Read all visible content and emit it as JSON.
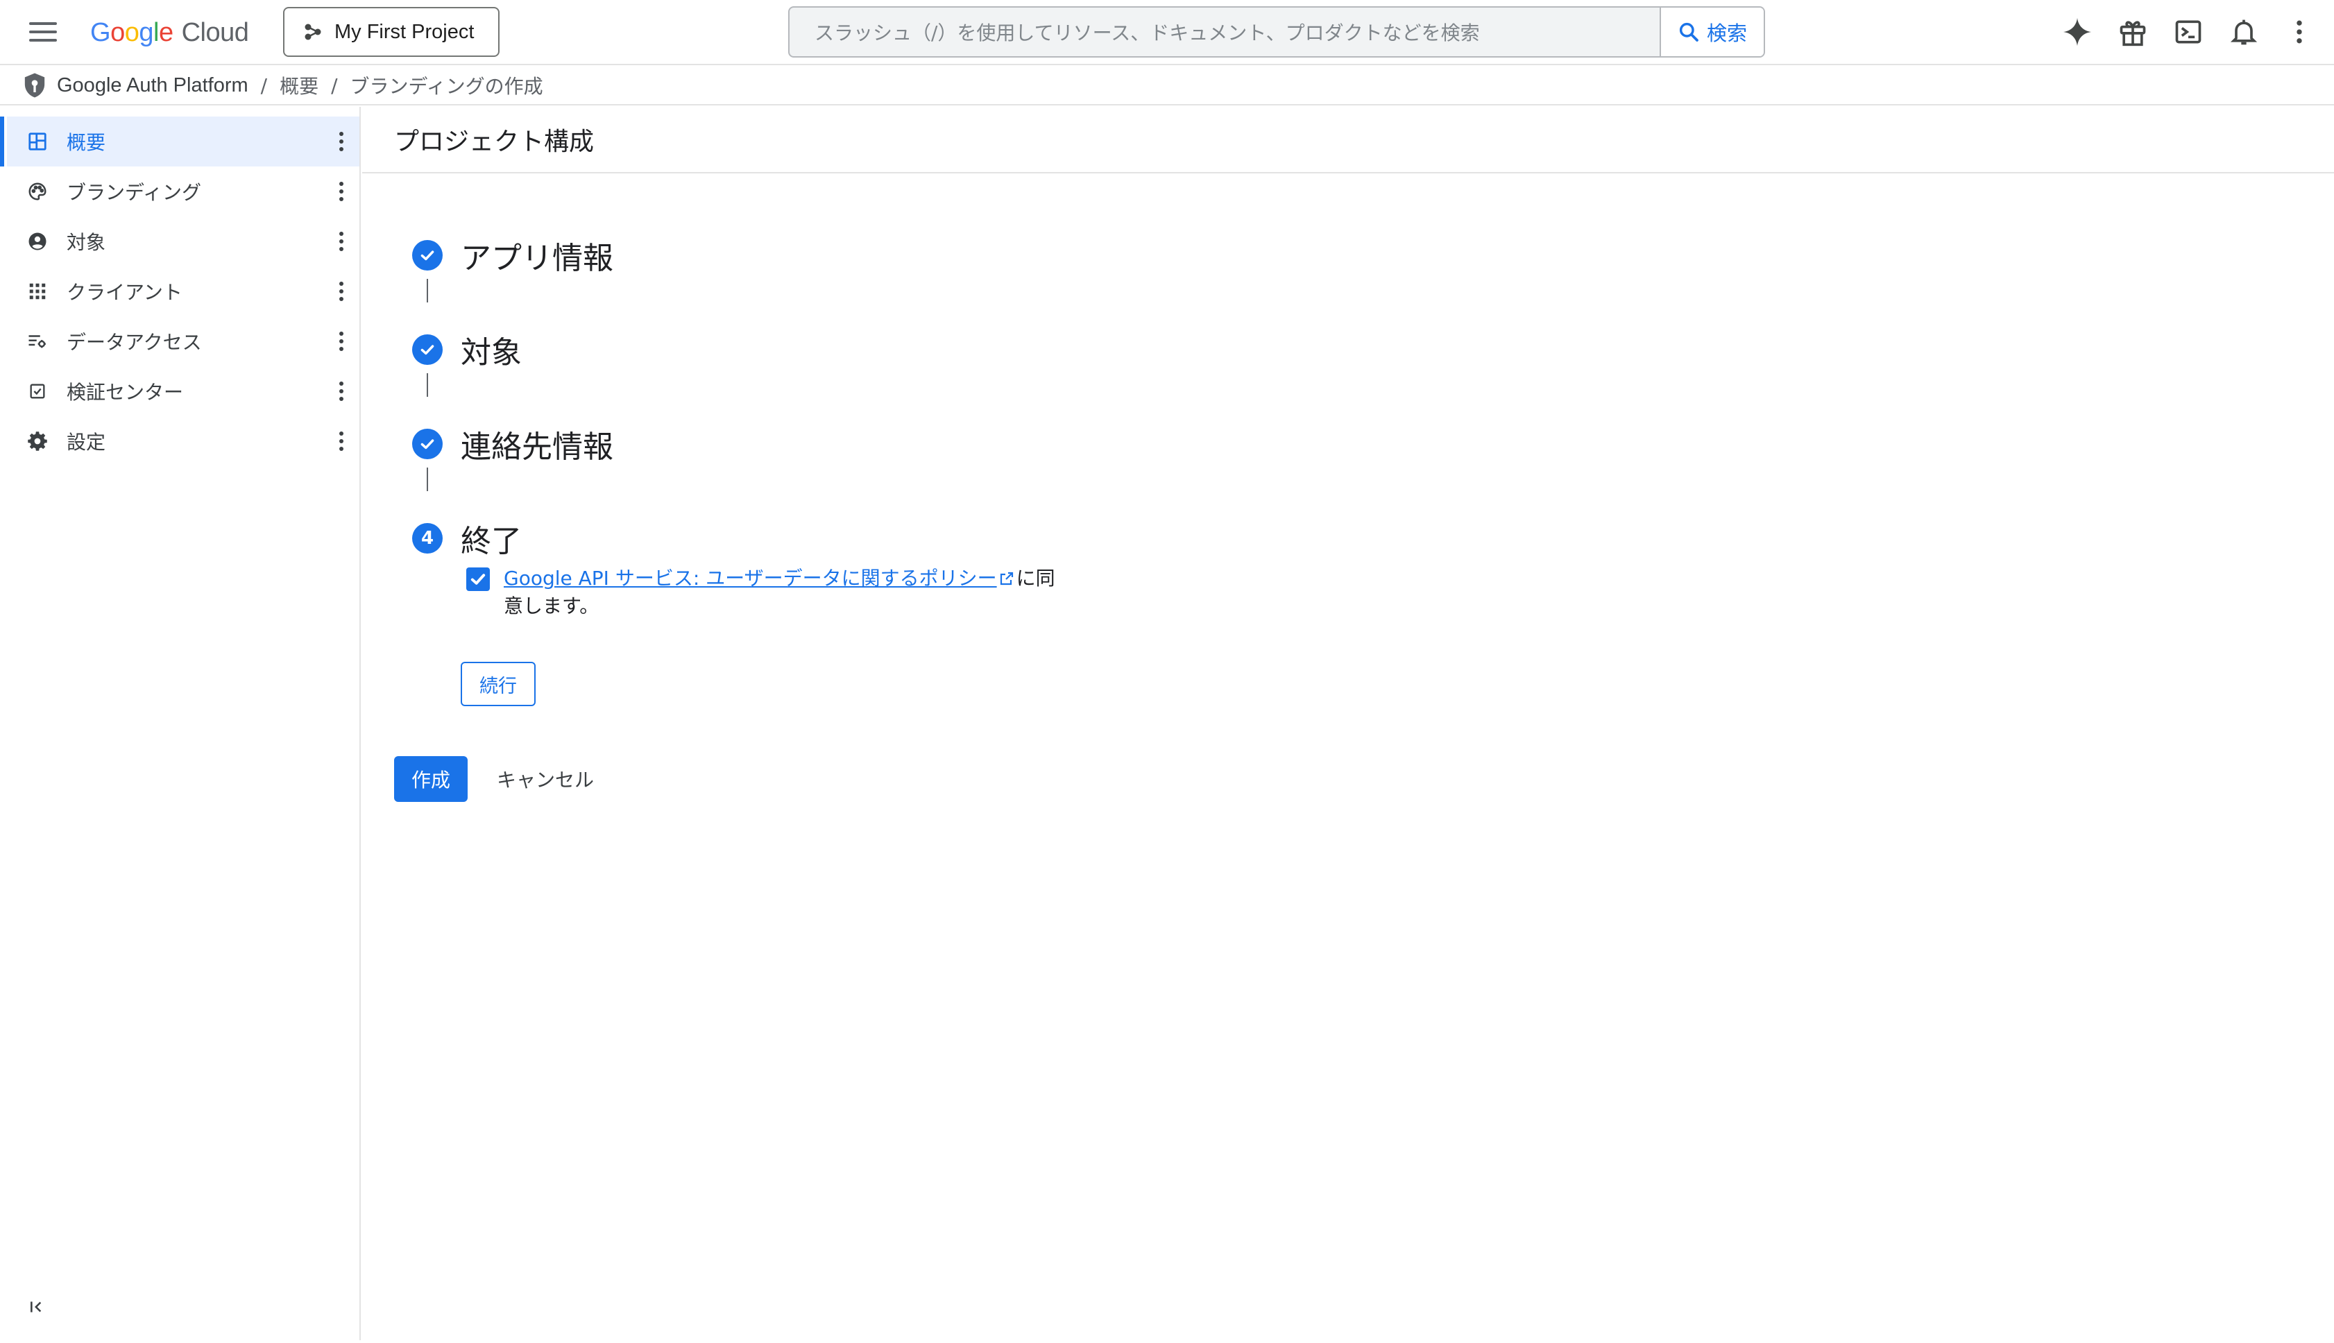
{
  "header": {
    "logo_letters": [
      "G",
      "o",
      "o",
      "g",
      "l",
      "e"
    ],
    "logo_product": "Cloud",
    "project_name": "My First Project",
    "search_placeholder": "スラッシュ（/）を使用してリソース、ドキュメント、プロダクトなどを検索",
    "search_button_label": "検索",
    "icons": [
      "gemini-sparkle-icon",
      "gift-icon",
      "cloud-shell-terminal-icon",
      "notifications-bell-icon",
      "more-vert-icon"
    ]
  },
  "breadcrumb": {
    "items": [
      "Google Auth Platform",
      "概要",
      "ブランディングの作成"
    ],
    "separator": "/"
  },
  "sidebar": {
    "items": [
      {
        "label": "概要",
        "icon": "dashboard-icon",
        "active": true
      },
      {
        "label": "ブランディング",
        "icon": "palette-icon",
        "active": false
      },
      {
        "label": "対象",
        "icon": "account-circle-icon",
        "active": false
      },
      {
        "label": "クライアント",
        "icon": "apps-grid-icon",
        "active": false
      },
      {
        "label": "データアクセス",
        "icon": "data-settings-icon",
        "active": false
      },
      {
        "label": "検証センター",
        "icon": "checkbox-icon",
        "active": false
      },
      {
        "label": "設定",
        "icon": "gear-icon",
        "active": false
      }
    ],
    "collapse_icon": "collapse-sidebar-icon"
  },
  "main": {
    "title": "プロジェクト構成",
    "steps": [
      {
        "label": "アプリ情報",
        "status": "complete"
      },
      {
        "label": "対象",
        "status": "complete"
      },
      {
        "label": "連絡先情報",
        "status": "complete"
      },
      {
        "label": "終了",
        "status": "current",
        "number": "4"
      }
    ],
    "consent": {
      "checked": true,
      "link_text": "Google API サービス: ユーザーデータに関するポリシー",
      "suffix_text": "に同意します。"
    },
    "continue_label": "続行",
    "create_label": "作成",
    "cancel_label": "キャンセル"
  },
  "colors": {
    "accent": "#1a73e8",
    "active_nav_bg": "#e8f0fe",
    "text": "#202124",
    "border": "#e3e3e3"
  }
}
